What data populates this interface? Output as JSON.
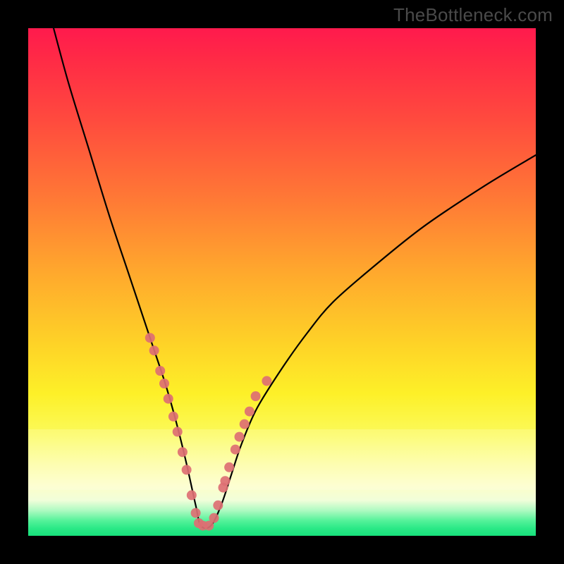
{
  "watermark": "TheBottleneck.com",
  "colors": {
    "frame": "#000000",
    "curve": "#000000",
    "dot": "#dd6f73"
  },
  "chart_data": {
    "type": "line",
    "title": "",
    "xlabel": "",
    "ylabel": "",
    "xlim": [
      0,
      100
    ],
    "ylim": [
      0,
      100
    ],
    "grid": false,
    "note": "Values estimated from unlabeled plot; y=0 at bottom (green), y=100 at top (red). Single V/check-shaped curve with minimum near x≈34.",
    "series": [
      {
        "name": "curve",
        "x": [
          5,
          8,
          12,
          16,
          20,
          24,
          27,
          29,
          31,
          33,
          34,
          36,
          38,
          40,
          42,
          45,
          50,
          55,
          60,
          68,
          78,
          90,
          100
        ],
        "y": [
          100,
          89,
          76,
          63,
          51,
          39,
          30,
          23,
          15,
          6,
          2,
          2,
          6,
          12,
          18,
          25,
          33,
          40,
          46,
          53,
          61,
          69,
          75
        ]
      }
    ],
    "highlight_points": {
      "name": "dots",
      "note": "Salmon markers clustered on both flanks of the valley and along the trough.",
      "x": [
        24.0,
        24.8,
        26.0,
        26.8,
        27.6,
        28.6,
        29.4,
        30.4,
        31.2,
        32.2,
        33.0,
        33.6,
        34.4,
        35.6,
        36.6,
        37.4,
        38.4,
        38.8,
        39.6,
        40.8,
        41.6,
        42.6,
        43.6,
        44.8,
        47.0
      ],
      "y": [
        39.0,
        36.5,
        32.5,
        30.0,
        27.0,
        23.5,
        20.5,
        16.5,
        13.0,
        8.0,
        4.5,
        2.5,
        2.0,
        2.0,
        3.5,
        6.0,
        9.5,
        10.8,
        13.5,
        17.0,
        19.5,
        22.0,
        24.5,
        27.5,
        30.5
      ]
    }
  }
}
